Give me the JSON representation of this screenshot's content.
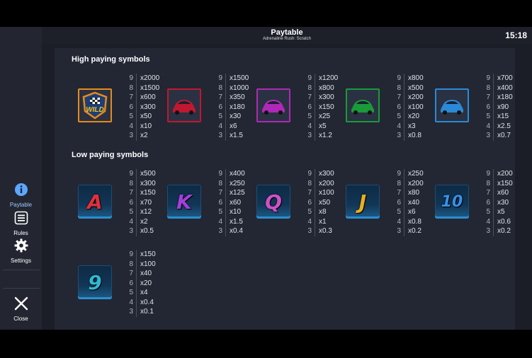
{
  "header": {
    "title": "Paytable",
    "subtitle": "Adrenaline Rush: Scratch",
    "clock": "15:18"
  },
  "sidebar": {
    "items": [
      {
        "label": "Paytable",
        "icon": "info-icon"
      },
      {
        "label": "Rules",
        "icon": "list-icon"
      },
      {
        "label": "Settings",
        "icon": "gear-icon"
      },
      {
        "label": "Close",
        "icon": "close-icon"
      }
    ]
  },
  "sections": {
    "high": "High paying symbols",
    "low": "Low paying symbols"
  },
  "counts": [
    "9",
    "8",
    "7",
    "6",
    "5",
    "4",
    "3"
  ],
  "high_symbols": [
    {
      "icon": "wild-icon",
      "label": "WILD",
      "color": "#e88a18",
      "pays": [
        "x2000",
        "x1500",
        "x600",
        "x300",
        "x50",
        "x10",
        "x2"
      ]
    },
    {
      "icon": "red-car-icon",
      "color": "#c01830",
      "pays": [
        "x1500",
        "x1000",
        "x350",
        "x180",
        "x30",
        "x6",
        "x1.5"
      ]
    },
    {
      "icon": "silver-car-icon",
      "color": "#b028b8",
      "pays": [
        "x1200",
        "x800",
        "x300",
        "x150",
        "x25",
        "x5",
        "x1.2"
      ]
    },
    {
      "icon": "green-car-icon",
      "color": "#1a9a3a",
      "pays": [
        "x800",
        "x500",
        "x200",
        "x100",
        "x20",
        "x3",
        "x0.8"
      ]
    },
    {
      "icon": "blue-car-icon",
      "color": "#2a8ad8",
      "pays": [
        "x700",
        "x400",
        "x180",
        "x90",
        "x15",
        "x2.5",
        "x0.7"
      ]
    }
  ],
  "low_symbols": [
    {
      "icon": "letter-a-icon",
      "label": "A",
      "color": "#e0303c",
      "pays": [
        "x500",
        "x300",
        "x150",
        "x70",
        "x12",
        "x2",
        "x0.5"
      ]
    },
    {
      "icon": "letter-k-icon",
      "label": "K",
      "color": "#a040d8",
      "pays": [
        "x400",
        "x250",
        "x125",
        "x60",
        "x10",
        "x1.5",
        "x0.4"
      ]
    },
    {
      "icon": "letter-q-icon",
      "label": "Q",
      "color": "#d050c8",
      "pays": [
        "x300",
        "x200",
        "x100",
        "x50",
        "x8",
        "x1",
        "x0.3"
      ]
    },
    {
      "icon": "letter-j-icon",
      "label": "J",
      "color": "#e8b020",
      "pays": [
        "x250",
        "x200",
        "x80",
        "x40",
        "x6",
        "x0.8",
        "x0.2"
      ]
    },
    {
      "icon": "number-10-icon",
      "label": "10",
      "color": "#3a90e8",
      "pays": [
        "x200",
        "x150",
        "x60",
        "x30",
        "x5",
        "x0.6",
        "x0.2"
      ]
    },
    {
      "icon": "number-9-icon",
      "label": "9",
      "color": "#30b8d0",
      "pays": [
        "x150",
        "x100",
        "x40",
        "x20",
        "x4",
        "x0.4",
        "x0.1"
      ]
    }
  ]
}
